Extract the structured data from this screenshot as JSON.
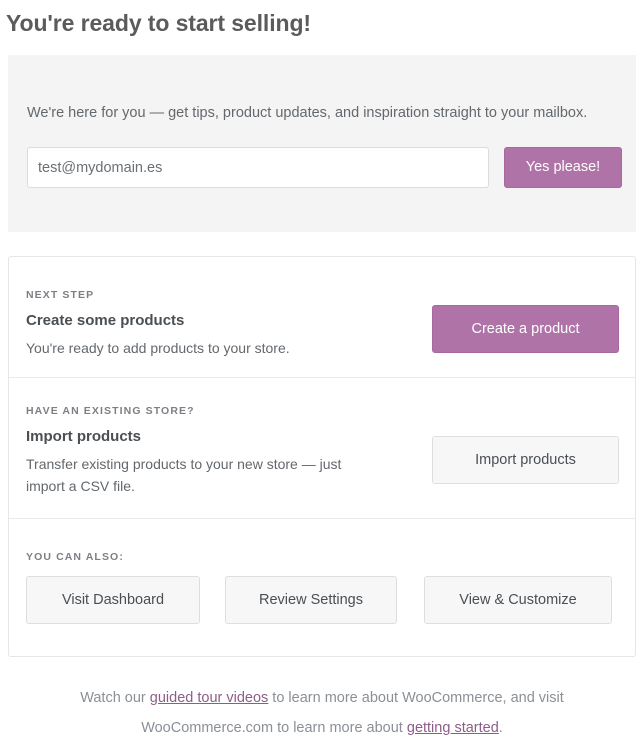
{
  "page_title": "You're ready to start selling!",
  "newsletter": {
    "copy": "We're here for you — get tips, product updates, and inspiration straight to your mailbox.",
    "email_value": "test@mydomain.es",
    "email_placeholder": "test@mydomain.es",
    "submit_label": "Yes please!"
  },
  "card": {
    "sections": [
      {
        "eyebrow": "NEXT STEP",
        "title": "Create some products",
        "description": "You're ready to add products to your store.",
        "button_label": "Create a product"
      },
      {
        "eyebrow": "HAVE AN EXISTING STORE?",
        "title": "Import products",
        "description": "Transfer existing products to your new store — just import a CSV file.",
        "button_label": "Import products"
      }
    ],
    "also": {
      "eyebrow": "YOU CAN ALSO:",
      "buttons": [
        {
          "label": "Visit Dashboard"
        },
        {
          "label": "Review Settings"
        },
        {
          "label": "View & Customize"
        }
      ]
    }
  },
  "footer": {
    "line1_prefix": "Watch our ",
    "link1": "guided tour videos",
    "line1_suffix": " to learn more about WooCommerce, and visit",
    "line2_prefix": "WooCommerce.com to learn more about ",
    "link2": "getting started",
    "line2_suffix": "."
  },
  "colors": {
    "accent_purple": "#b073a8",
    "link_purple": "#8d5d8a",
    "panel_gray": "#f4f4f4",
    "card_border": "#e6e6e6",
    "button_face": "#f7f7f7",
    "text_dark": "#4a4f54",
    "text_body": "#63686d",
    "text_muted": "#8b9096"
  }
}
